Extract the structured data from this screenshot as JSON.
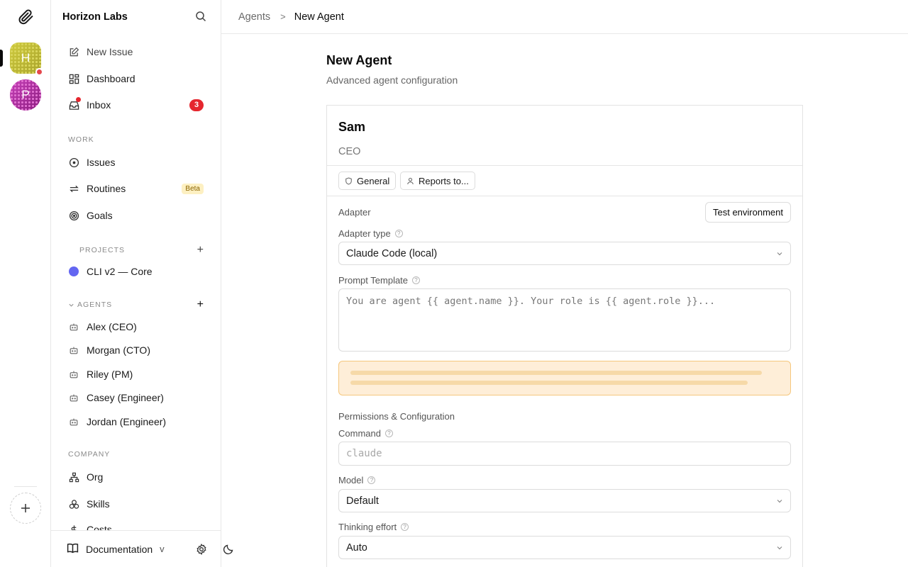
{
  "workspaces": [
    {
      "initial": "H",
      "color": "#c8c33a",
      "active": true,
      "has_notification": true
    },
    {
      "initial": "P",
      "color": "#b23aa6",
      "active": false
    }
  ],
  "sidebar": {
    "company_name": "Horizon Labs",
    "top_items": [
      {
        "label": "New Issue",
        "icon": "edit-icon"
      },
      {
        "label": "Dashboard",
        "icon": "dashboard-icon"
      },
      {
        "label": "Inbox",
        "icon": "inbox-icon",
        "count": "3"
      }
    ],
    "work_label": "WORK",
    "work_items": [
      {
        "label": "Issues",
        "icon": "issues-icon"
      },
      {
        "label": "Routines",
        "icon": "routines-icon",
        "badge": "Beta"
      },
      {
        "label": "Goals",
        "icon": "goals-icon"
      }
    ],
    "projects_label": "PROJECTS",
    "projects": [
      {
        "label": "CLI v2 — Core",
        "color": "#6366f1"
      }
    ],
    "agents_label": "AGENTS",
    "agents": [
      {
        "label": "Alex (CEO)"
      },
      {
        "label": "Morgan (CTO)"
      },
      {
        "label": "Riley (PM)"
      },
      {
        "label": "Casey (Engineer)"
      },
      {
        "label": "Jordan (Engineer)"
      }
    ],
    "company_label": "COMPANY",
    "company_items": [
      {
        "label": "Org",
        "icon": "org-icon"
      },
      {
        "label": "Skills",
        "icon": "skills-icon"
      },
      {
        "label": "Costs",
        "icon": "costs-icon"
      }
    ],
    "footer": {
      "documentation": "Documentation",
      "version": "v"
    }
  },
  "breadcrumb": {
    "parent": "Agents",
    "separator": ">",
    "current": "New Agent"
  },
  "page": {
    "title": "New Agent",
    "subtitle": "Advanced agent configuration"
  },
  "agent": {
    "name": "Sam",
    "role": "CEO"
  },
  "chips": [
    {
      "label": "General",
      "icon": "shield-icon"
    },
    {
      "label": "Reports to...",
      "icon": "user-icon"
    }
  ],
  "adapter": {
    "section_title": "Adapter",
    "test_button": "Test environment",
    "type_label": "Adapter type",
    "type_value": "Claude Code (local)",
    "prompt_label": "Prompt Template",
    "prompt_placeholder": "You are agent {{ agent.name }}. Your role is {{ agent.role }}..."
  },
  "permissions": {
    "section_title": "Permissions & Configuration",
    "command_label": "Command",
    "command_placeholder": "claude",
    "model_label": "Model",
    "model_value": "Default",
    "effort_label": "Thinking effort",
    "effort_value": "Auto"
  }
}
